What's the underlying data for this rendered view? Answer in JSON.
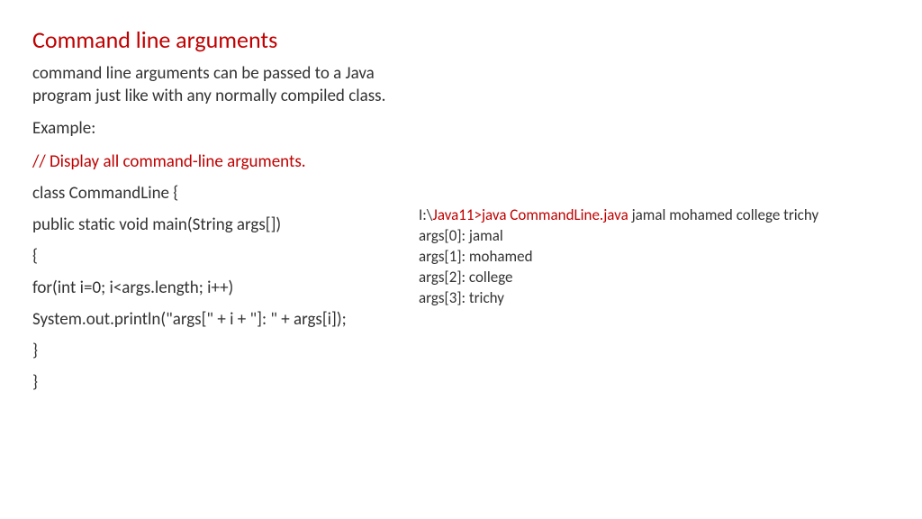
{
  "title": "Command line arguments",
  "intro": "command line arguments can be passed to a Java program just like with any normally compiled class.",
  "example_label": "Example:",
  "comment": "// Display all command-line arguments.",
  "code_lines": [
    "class CommandLine {",
    "public static void main(String args[])",
    "{",
    "for(int i=0; i<args.length; i++)",
    "System.out.println(\"args[\" + i + \"]: \" + args[i]);",
    "}",
    "}"
  ],
  "terminal": {
    "prefix": "I:\\",
    "command": "Java11>java CommandLine.java",
    "suffix": " jamal mohamed college trichy",
    "output": [
      "args[0]: jamal",
      "args[1]: mohamed",
      "args[2]: college",
      "args[3]: trichy"
    ]
  }
}
